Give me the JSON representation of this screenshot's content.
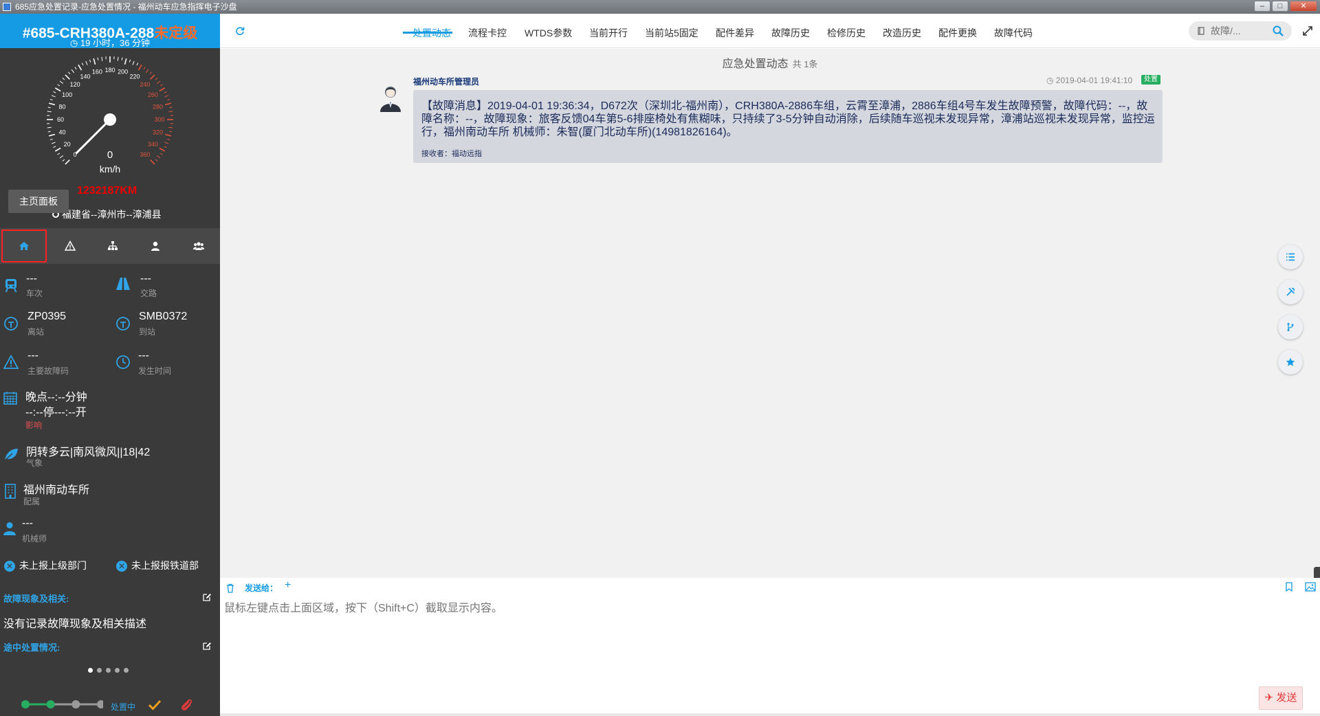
{
  "window": {
    "title": "685应急处置记录-应急处置情况 - 福州动车应急指挥电子沙盘",
    "minimize": "–",
    "maximize": "□",
    "close": "✕"
  },
  "train": {
    "title": "#685-CRH380A-288",
    "level": "未定级",
    "duration": "◷ 19 小时，36 分钟"
  },
  "speedometer": {
    "ticks": [
      "0",
      "20",
      "40",
      "60",
      "80",
      "100",
      "120",
      "140",
      "160",
      "180",
      "200",
      "220",
      "240",
      "260",
      "280",
      "300",
      "320",
      "340",
      "360"
    ],
    "value": "0",
    "unit": "km/h",
    "speed": 0
  },
  "mileage": "1232187KM",
  "tooltip": "主页面板",
  "location": "福建省--漳州市--漳浦县",
  "sidebar_tabs": [
    "home-icon",
    "warning-icon",
    "sitemap-icon",
    "user-icon",
    "users-icon"
  ],
  "info": {
    "train_no": {
      "value": "---",
      "label": "车次"
    },
    "route": {
      "value": "---",
      "label": "交路"
    },
    "depart_station": {
      "value": "ZP0395",
      "label": "离站"
    },
    "arrive_station": {
      "value": "SMB0372",
      "label": "到站"
    },
    "fault_code": {
      "value": "---",
      "label": "主要故障码"
    },
    "occur_time": {
      "value": "---",
      "label": "发生时间"
    },
    "delay_line1": "晚点--:--分钟",
    "delay_line2": "--:--停---:--开",
    "delay_label": "影响",
    "weather": {
      "value": "阴转多云|南风微风||18|42",
      "label": "气象"
    },
    "depot": {
      "value": "福州南动车所",
      "label": "配属"
    },
    "driver": {
      "value": "---",
      "label": "机械师"
    }
  },
  "report": {
    "upper": "未上报上级部门",
    "railway": "未上报报铁道部"
  },
  "fault_section": {
    "label": "故障现象及相关:",
    "desc": "没有记录故障现象及相关描述"
  },
  "enroute_section": {
    "label": "途中处置情况:"
  },
  "status": {
    "text": "处置中",
    "steps_done": 2,
    "steps_total": 4
  },
  "nav": {
    "tabs": [
      "处置动态",
      "流程卡控",
      "WTDS参数",
      "当前开行",
      "当前站5固定",
      "配件差异",
      "故障历史",
      "检修历史",
      "改造历史",
      "配件更换",
      "故障代码"
    ],
    "active": 0,
    "search_placeholder": "故障/..."
  },
  "content": {
    "title": "应急处置动态",
    "count": "共 1条"
  },
  "message": {
    "sender": "福州动车所管理员",
    "time": "◷ 2019-04-01 19:41:10",
    "badge": "处置",
    "text": "【故障消息】2019-04-01 19:36:34，D672次（深圳北-福州南），CRH380A-2886车组，云霄至漳浦，2886车组4号车发生故障预警，故障代码：--，故障名称：--，故障现象：旅客反馈04车第5-6排座椅处有焦糊味，只持续了3-5分钟自动消除，后续随车巡视未发现异常，漳浦站巡视未发现异常，监控运行，福州南动车所 机械师：朱智(厦门北动车所)(14981826164)。",
    "receiver": "接收者：福动远指"
  },
  "fabs": [
    "list-icon",
    "tools-icon",
    "branch-icon",
    "star-icon"
  ],
  "compose": {
    "sendto_label": "发送给：",
    "add": "+",
    "placeholder": "鼠标左键点击上面区域，按下（Shift+C）截取显示内容。",
    "send_label": "✈ 发送"
  },
  "colors": {
    "accent": "#149be3",
    "sidebar_bg": "#3a3a3a",
    "level": "#ff6a2a",
    "mileage": "#e00000",
    "badge": "#27ae60"
  }
}
